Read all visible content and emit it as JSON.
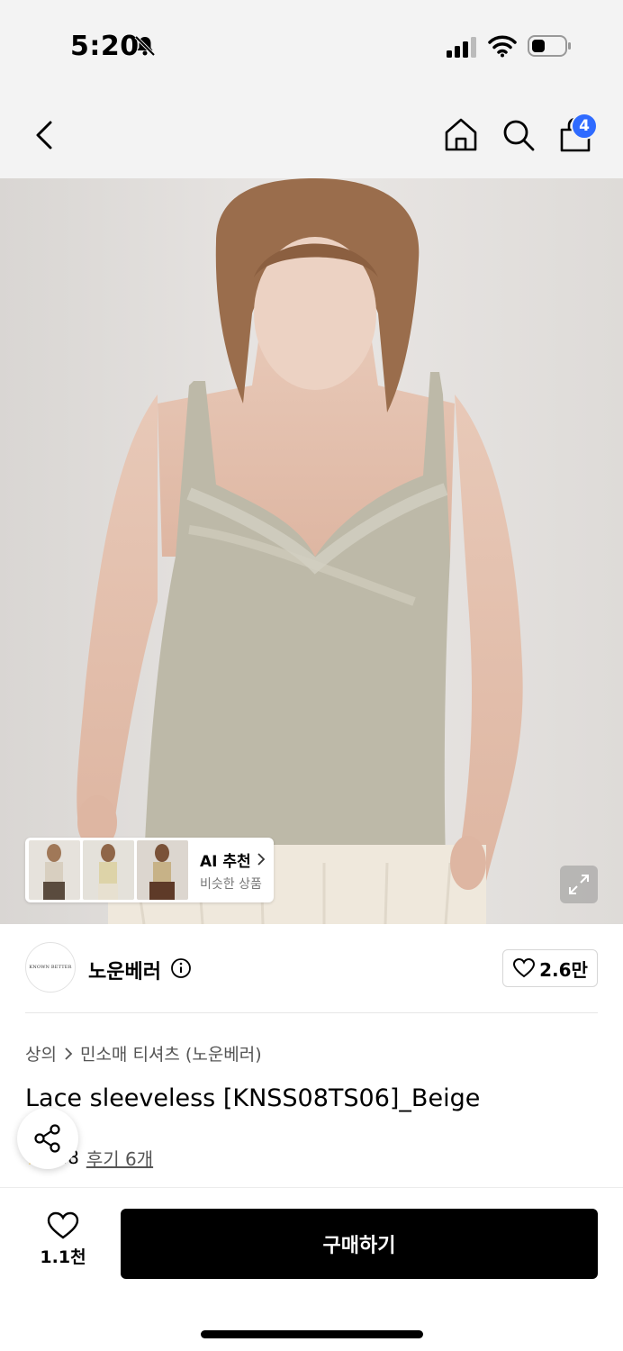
{
  "status": {
    "time": "5:20"
  },
  "nav": {
    "cart_count": "4"
  },
  "ai_recommend": {
    "title": "AI 추천",
    "subtitle": "비슷한 상품"
  },
  "brand": {
    "logo_text": "KNOWN BETTER",
    "name": "노운베러",
    "likes": "2.6만"
  },
  "breadcrumb": {
    "category": "상의",
    "subcategory": "민소매 티셔츠 (노운베러)"
  },
  "product": {
    "title": "Lace sleeveless [KNSS08TS06]_Beige",
    "rating": "4.8",
    "reviews": "후기 6개"
  },
  "bottom": {
    "wish_count": "1.1천",
    "buy_label": "구매하기"
  },
  "colors": {
    "accent_badge": "#2f6bff",
    "buy_button": "#000000",
    "top_color": "#bdb9a8"
  }
}
